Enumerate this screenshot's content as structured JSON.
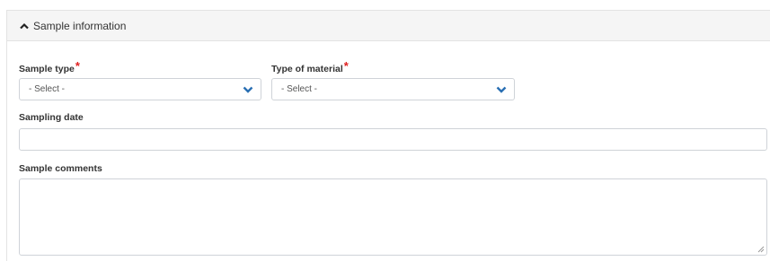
{
  "panel": {
    "title": "Sample information",
    "toggle_icon": "chevron-up-icon"
  },
  "fields": {
    "sample_type": {
      "label": "Sample type",
      "required_marker": "*",
      "value": "- Select -",
      "icon": "chevron-down-icon"
    },
    "type_of_material": {
      "label": "Type of material",
      "required_marker": "*",
      "value": "- Select -",
      "icon": "chevron-down-icon"
    },
    "sampling_date": {
      "label": "Sampling date",
      "value": ""
    },
    "sample_comments": {
      "label": "Sample comments",
      "value": ""
    }
  },
  "colors": {
    "required": "#e02020",
    "chevron": "#2a6fb3",
    "header_bg": "#f5f5f5"
  }
}
